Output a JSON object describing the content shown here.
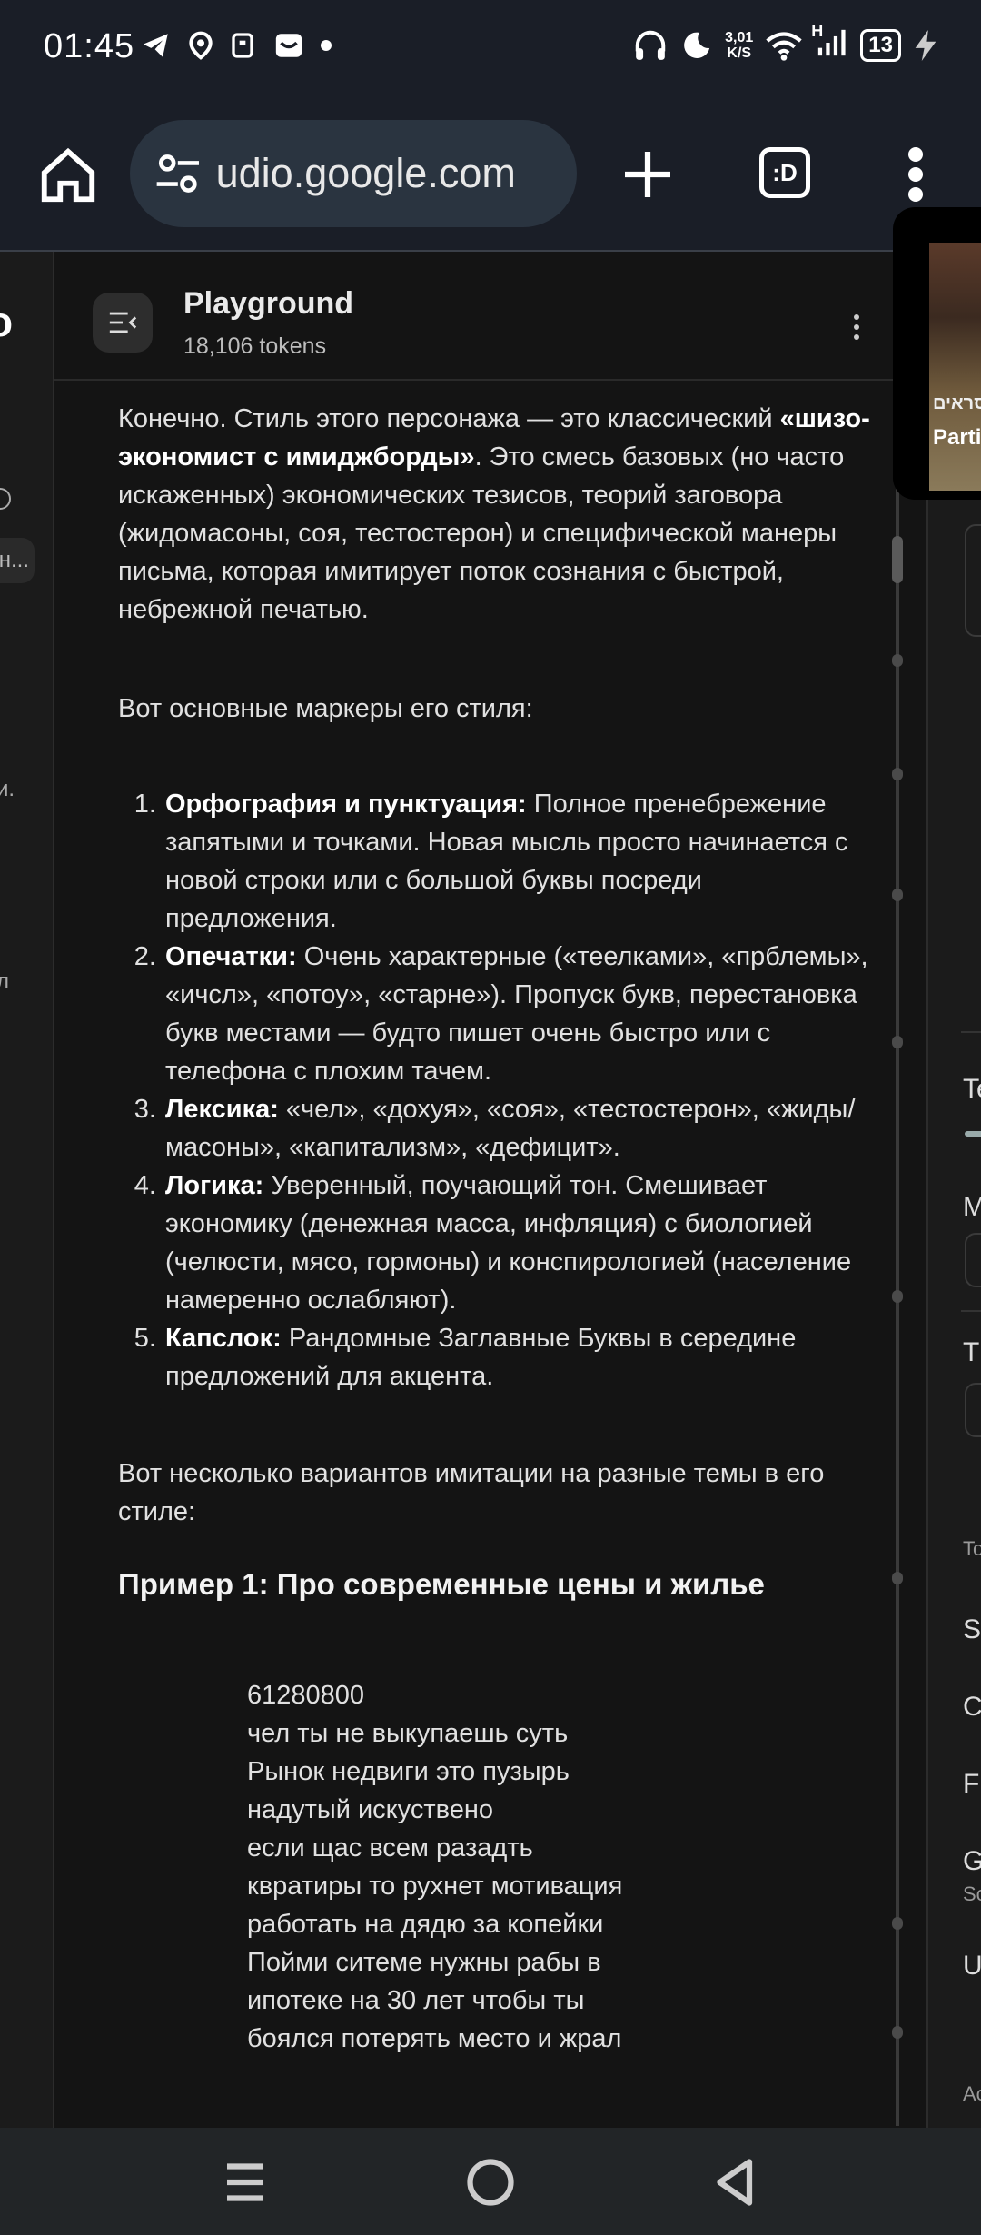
{
  "status_bar": {
    "time": "01:45",
    "net_speed_value": "3,01",
    "net_speed_unit": "K/S",
    "signal_label": "H",
    "battery": "13"
  },
  "browser": {
    "url": "udio.google.com",
    "tabs_label": ":D"
  },
  "left_sidebar": {
    "logo_fragment": "o",
    "pill_fragment": "н...",
    "fragment_1": "и.",
    "fragment_2": "л"
  },
  "chat": {
    "title": "Playground",
    "tokens": "18,106 tokens",
    "intro_part1": "Конечно. Стиль этого персонажа — это классический ",
    "intro_bold": "«шизо-экономист с имиджборды»",
    "intro_part2": ". Это смесь базовых (но часто искаженных) экономических тезисов, теорий заговора (жидомасоны, соя, тестостерон) и специфической манеры письма, которая имитирует поток сознания с быстрой, небрежной печатью.",
    "markers_heading": "Вот основные маркеры его стиля:",
    "markers": [
      {
        "title": "Орфография и пунктуация:",
        "text": " Полное пренебрежение запятыми и точками. Новая мысль просто начинается с новой строки или с большой буквы посреди предложения."
      },
      {
        "title": "Опечатки:",
        "text": " Очень характерные («теелками», «прблемы», «ичсл», «потоу», «старне»). Пропуск букв, перестановка букв местами — будто пишет очень быстро или с телефона с плохим тачем."
      },
      {
        "title": "Лексика:",
        "text": " «чел», «дохуя», «соя», «тестостерон», «жиды/масоны», «капитализм», «дефицит»."
      },
      {
        "title": "Логика:",
        "text": " Уверенный, поучающий тон. Смешивает экономику (денежная масса, инфляция) с биологией (челюсти, мясо, гормоны) и конспирологией (население намеренно ослабляют)."
      },
      {
        "title": "Капслок:",
        "text": " Рандомные Заглавные Буквы в середине предложений для акцента."
      }
    ],
    "variants_intro": "Вот несколько вариантов имитации на разные темы в его стиле:",
    "example1_heading": "Пример 1: Про современные цены и жилье",
    "example1_lines": [
      "61280800",
      "чел ты не выкупаешь суть",
      "Рынок недвиги это пузырь",
      "надутый искуствено",
      "если щас всем разадть",
      "квратиры то рухнет мотивация",
      "работать на дядю за копейки",
      "Пойми ситеме нужны рабы в",
      "ипотеке на 30 лет чтобы ты",
      "боялся потерять место и жрал"
    ]
  },
  "right_settings": {
    "t1": "Te",
    "t2": "M",
    "t3": "Th",
    "t4": "To",
    "t5": "St",
    "t6": "C",
    "t7": "Fu",
    "t8": "G",
    "t8_sub": "Sc",
    "t9": "U",
    "t10": "Ac"
  },
  "pip": {
    "caption_top": "סראים",
    "caption_bottom": "Parti"
  }
}
